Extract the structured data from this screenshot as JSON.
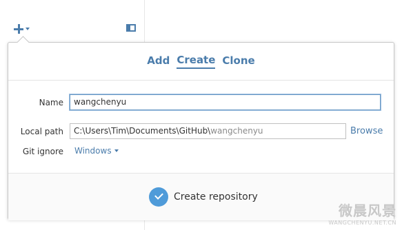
{
  "toolbar": {
    "add_icon": "plus-icon",
    "caret_icon": "chevron-down-icon",
    "panel_icon": "sidebar-toggle-icon"
  },
  "tabs": [
    {
      "label": "Add",
      "active": false
    },
    {
      "label": "Create",
      "active": true
    },
    {
      "label": "Clone",
      "active": false
    }
  ],
  "form": {
    "name_label": "Name",
    "name_value": "wangchenyu",
    "local_path_label": "Local path",
    "local_path_base": "C:\\Users\\Tim\\Documents\\GitHub\\",
    "local_path_repo": "wangchenyu",
    "browse_label": "Browse",
    "git_ignore_label": "Git ignore",
    "git_ignore_value": "Windows"
  },
  "footer": {
    "create_label": "Create repository",
    "create_icon": "check-circle-icon"
  },
  "watermark": {
    "main": "微晨风景",
    "sub": "WANGCHENYU.NET.CN"
  },
  "colors": {
    "accent": "#4a7cab",
    "button": "#4f9bd9"
  }
}
